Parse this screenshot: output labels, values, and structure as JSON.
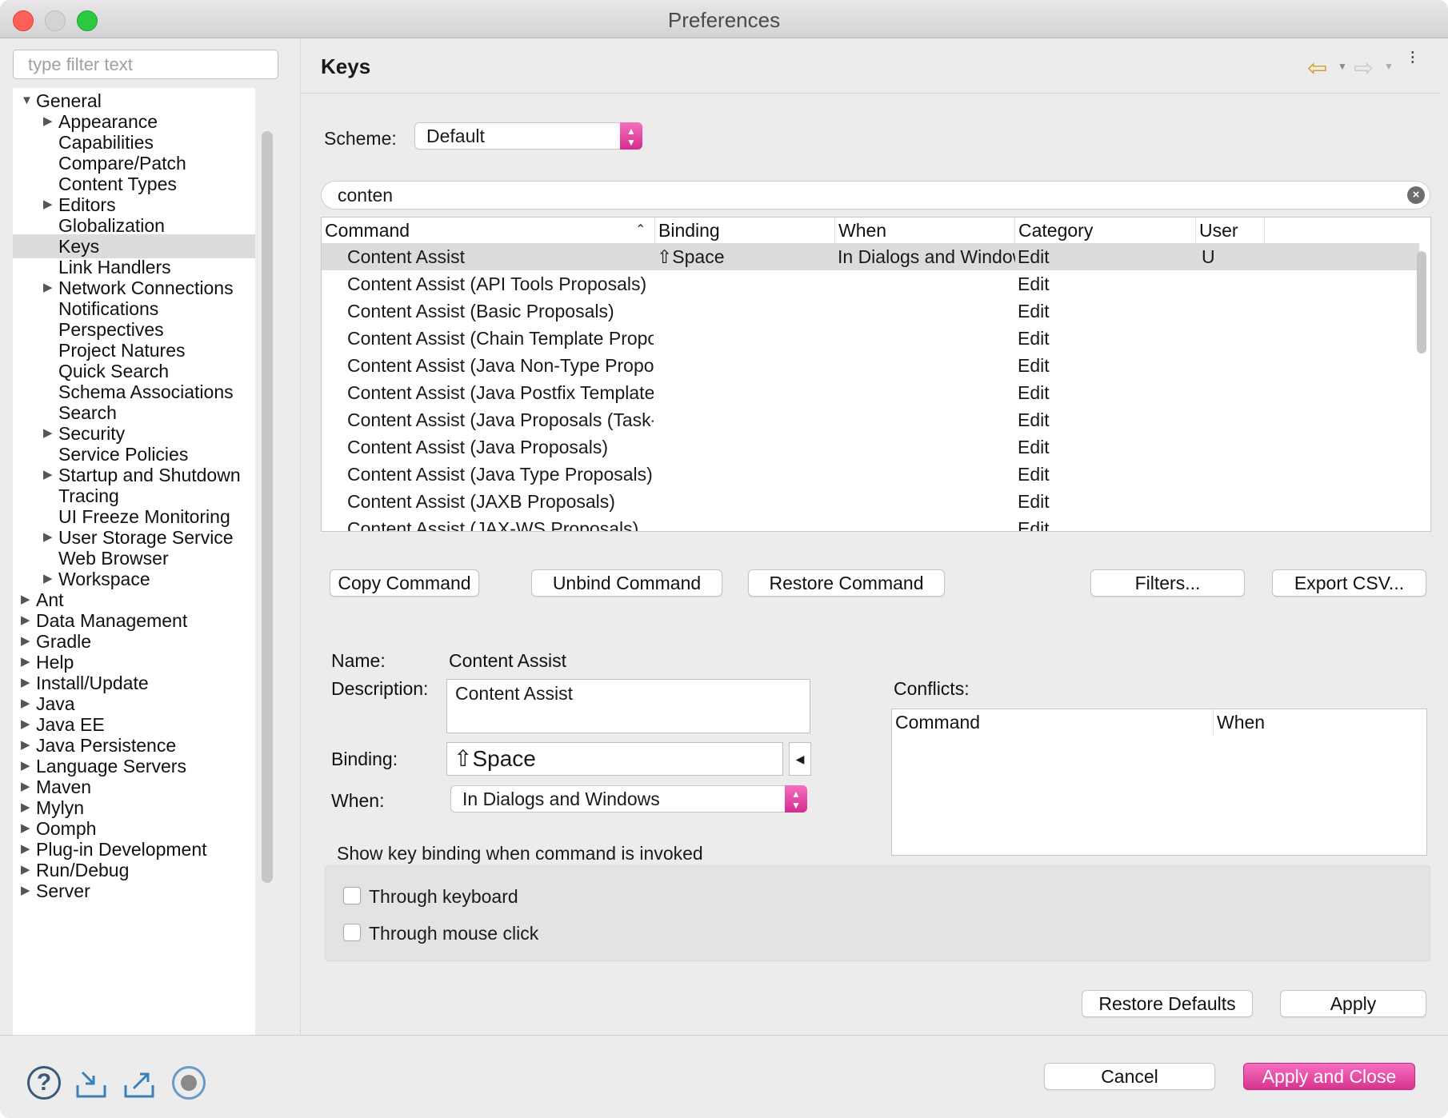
{
  "window": {
    "title": "Preferences"
  },
  "filter": {
    "placeholder": "type filter text"
  },
  "tree": [
    {
      "label": "General",
      "level": 0,
      "expandable": true,
      "expanded": true
    },
    {
      "label": "Appearance",
      "level": 1,
      "expandable": true
    },
    {
      "label": "Capabilities",
      "level": 1
    },
    {
      "label": "Compare/Patch",
      "level": 1
    },
    {
      "label": "Content Types",
      "level": 1
    },
    {
      "label": "Editors",
      "level": 1,
      "expandable": true
    },
    {
      "label": "Globalization",
      "level": 1
    },
    {
      "label": "Keys",
      "level": 1,
      "selected": true
    },
    {
      "label": "Link Handlers",
      "level": 1
    },
    {
      "label": "Network Connections",
      "level": 1,
      "expandable": true
    },
    {
      "label": "Notifications",
      "level": 1
    },
    {
      "label": "Perspectives",
      "level": 1
    },
    {
      "label": "Project Natures",
      "level": 1
    },
    {
      "label": "Quick Search",
      "level": 1
    },
    {
      "label": "Schema Associations",
      "level": 1
    },
    {
      "label": "Search",
      "level": 1
    },
    {
      "label": "Security",
      "level": 1,
      "expandable": true
    },
    {
      "label": "Service Policies",
      "level": 1
    },
    {
      "label": "Startup and Shutdown",
      "level": 1,
      "expandable": true
    },
    {
      "label": "Tracing",
      "level": 1
    },
    {
      "label": "UI Freeze Monitoring",
      "level": 1
    },
    {
      "label": "User Storage Service",
      "level": 1,
      "expandable": true
    },
    {
      "label": "Web Browser",
      "level": 1
    },
    {
      "label": "Workspace",
      "level": 1,
      "expandable": true
    },
    {
      "label": "Ant",
      "level": 0,
      "expandable": true
    },
    {
      "label": "Data Management",
      "level": 0,
      "expandable": true
    },
    {
      "label": "Gradle",
      "level": 0,
      "expandable": true
    },
    {
      "label": "Help",
      "level": 0,
      "expandable": true
    },
    {
      "label": "Install/Update",
      "level": 0,
      "expandable": true
    },
    {
      "label": "Java",
      "level": 0,
      "expandable": true
    },
    {
      "label": "Java EE",
      "level": 0,
      "expandable": true
    },
    {
      "label": "Java Persistence",
      "level": 0,
      "expandable": true
    },
    {
      "label": "Language Servers",
      "level": 0,
      "expandable": true
    },
    {
      "label": "Maven",
      "level": 0,
      "expandable": true
    },
    {
      "label": "Mylyn",
      "level": 0,
      "expandable": true
    },
    {
      "label": "Oomph",
      "level": 0,
      "expandable": true
    },
    {
      "label": "Plug-in Development",
      "level": 0,
      "expandable": true
    },
    {
      "label": "Run/Debug",
      "level": 0,
      "expandable": true
    },
    {
      "label": "Server",
      "level": 0,
      "expandable": true
    }
  ],
  "page": {
    "title": "Keys",
    "scheme_label": "Scheme:",
    "scheme_value": "Default",
    "search_value": "conten",
    "columns": [
      "Command",
      "Binding",
      "When",
      "Category",
      "User"
    ],
    "rows": [
      {
        "command": "Content Assist",
        "binding": "⇧Space",
        "when": "In Dialogs and Windows",
        "category": "Edit",
        "user": "U",
        "selected": true
      },
      {
        "command": "Content Assist (API Tools Proposals)",
        "binding": "",
        "when": "",
        "category": "Edit",
        "user": ""
      },
      {
        "command": "Content Assist (Basic Proposals)",
        "binding": "",
        "when": "",
        "category": "Edit",
        "user": ""
      },
      {
        "command": "Content Assist (Chain Template Proposals)",
        "binding": "",
        "when": "",
        "category": "Edit",
        "user": ""
      },
      {
        "command": "Content Assist (Java Non-Type Proposals)",
        "binding": "",
        "when": "",
        "category": "Edit",
        "user": ""
      },
      {
        "command": "Content Assist (Java Postfix Template P...",
        "binding": "",
        "when": "",
        "category": "Edit",
        "user": ""
      },
      {
        "command": "Content Assist (Java Proposals (Task-F...",
        "binding": "",
        "when": "",
        "category": "Edit",
        "user": ""
      },
      {
        "command": "Content Assist (Java Proposals)",
        "binding": "",
        "when": "",
        "category": "Edit",
        "user": ""
      },
      {
        "command": "Content Assist (Java Type Proposals)",
        "binding": "",
        "when": "",
        "category": "Edit",
        "user": ""
      },
      {
        "command": "Content Assist (JAXB Proposals)",
        "binding": "",
        "when": "",
        "category": "Edit",
        "user": ""
      },
      {
        "command": "Content Assist (JAX-WS Proposals)",
        "binding": "",
        "when": "",
        "category": "Edit",
        "user": ""
      }
    ],
    "buttons": {
      "copy": "Copy Command",
      "unbind": "Unbind Command",
      "restore": "Restore Command",
      "filters": "Filters...",
      "export": "Export CSV..."
    },
    "detail": {
      "name_label": "Name:",
      "name_value": "Content Assist",
      "description_label": "Description:",
      "description_value": "Content Assist",
      "binding_label": "Binding:",
      "binding_value": "⇧Space",
      "when_label": "When:",
      "when_value": "In Dialogs and Windows",
      "conflicts_label": "Conflicts:",
      "conflict_columns": [
        "Command",
        "When"
      ]
    },
    "show_binding": {
      "title": "Show key binding when command is invoked",
      "through_keyboard": "Through keyboard",
      "through_mouse": "Through mouse click"
    },
    "restore_defaults": "Restore Defaults",
    "apply": "Apply"
  },
  "footer": {
    "cancel": "Cancel",
    "apply_close": "Apply and Close"
  },
  "icons": {
    "back": "back-arrow-icon",
    "forward": "forward-arrow-icon",
    "menu": "view-menu-icon",
    "help": "help-icon",
    "import": "import-icon",
    "export": "export-icon",
    "record": "record-icon",
    "clear": "clear-search-icon"
  },
  "colors": {
    "accent": "#e0459c",
    "selection": "#dcdcdc"
  }
}
